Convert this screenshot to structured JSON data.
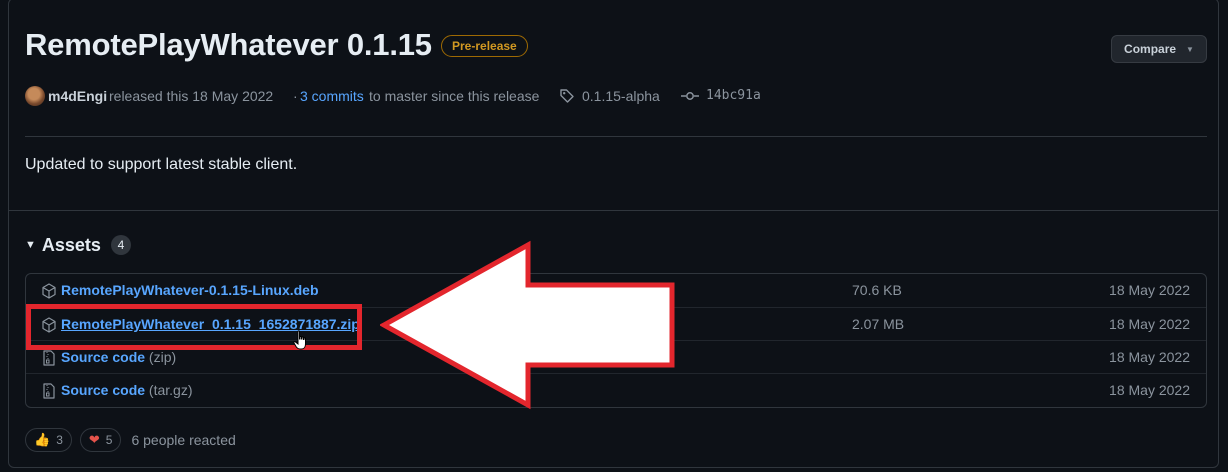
{
  "release": {
    "title": "RemotePlayWhatever 0.1.15",
    "badge": "Pre-release",
    "compare_label": "Compare",
    "author": "m4dEngi",
    "released_text": "released this 18 May 2022",
    "separator": "·",
    "commits_link": "3 commits",
    "commits_suffix": "to master since this release",
    "tag": "0.1.15-alpha",
    "commit_hash": "14bc91a",
    "body": "Updated to support latest stable client."
  },
  "assets": {
    "title": "Assets",
    "count": "4",
    "items": [
      {
        "name": "RemotePlayWhatever-0.1.15-Linux.deb",
        "ext": "",
        "size": "70.6 KB",
        "date": "18 May 2022",
        "icon": "package-icon"
      },
      {
        "name": "RemotePlayWhatever_0.1.15_1652871887.zip",
        "ext": "",
        "size": "2.07 MB",
        "date": "18 May 2022",
        "icon": "package-icon"
      },
      {
        "name": "Source code",
        "ext": "(zip)",
        "size": "",
        "date": "18 May 2022",
        "icon": "file-zip-icon"
      },
      {
        "name": "Source code",
        "ext": "(tar.gz)",
        "size": "",
        "date": "18 May 2022",
        "icon": "file-zip-icon"
      }
    ]
  },
  "reactions": {
    "thumbs_up": {
      "emoji": "👍",
      "count": "3"
    },
    "heart": {
      "emoji": "❤",
      "count": "5"
    },
    "summary": "6 people reacted"
  },
  "colors": {
    "background": "#0d1117",
    "link": "#58a6ff",
    "prerelease": "#d29922",
    "highlight": "#e3262d"
  }
}
